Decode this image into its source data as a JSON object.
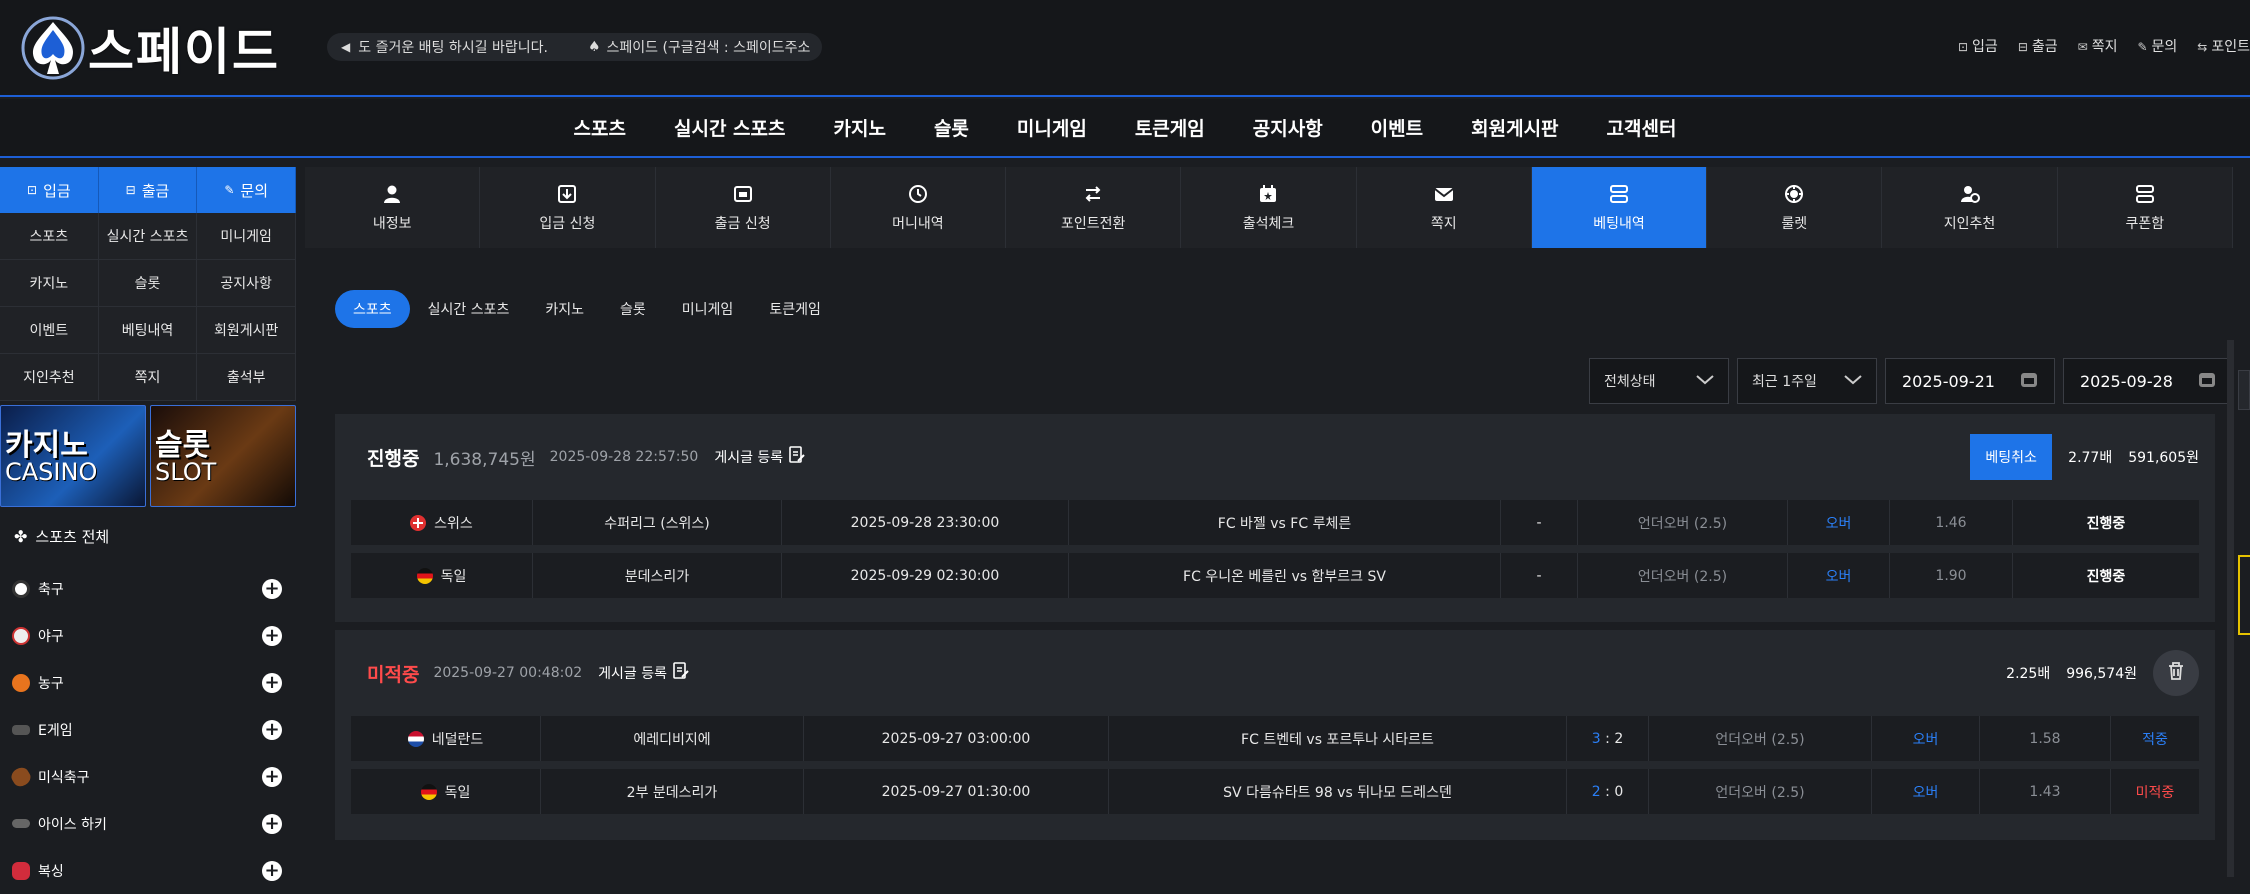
{
  "brand": {
    "name": "스페이드"
  },
  "notice": {
    "text1": "도 즐거운 배팅 하시길 바랍니다.",
    "text2": "스페이드 (구글검색 : 스페이드주소"
  },
  "toplinks": [
    {
      "label": "입금",
      "icon": "deposit-icon"
    },
    {
      "label": "출금",
      "icon": "withdraw-icon"
    },
    {
      "label": "쪽지",
      "icon": "mail-icon"
    },
    {
      "label": "문의",
      "icon": "inquiry-icon"
    },
    {
      "label": "포인트",
      "icon": "point-icon"
    }
  ],
  "mainnav": [
    "스포츠",
    "실시간 스포츠",
    "카지노",
    "슬롯",
    "미니게임",
    "토큰게임",
    "공지사항",
    "이벤트",
    "회원게시판",
    "고객센터"
  ],
  "sidebar": {
    "quick": [
      "입금",
      "출금",
      "문의"
    ],
    "grid": [
      "스포츠",
      "실시간 스포츠",
      "미니게임",
      "카지노",
      "슬롯",
      "공지사항",
      "이벤트",
      "베팅내역",
      "회원게시판",
      "지인추천",
      "쪽지",
      "출석부"
    ],
    "banners": [
      {
        "title": "카지노",
        "sub": "CASINO"
      },
      {
        "title": "슬롯",
        "sub": "SLOT"
      }
    ],
    "sports_all": "스포츠 전체",
    "sports": [
      {
        "name": "축구",
        "color": "#ffffff"
      },
      {
        "name": "야구",
        "color": "#e8e8e8"
      },
      {
        "name": "농구",
        "color": "#e8741e"
      },
      {
        "name": "E게임",
        "color": "#888888"
      },
      {
        "name": "미식축구",
        "color": "#8a4b1e"
      },
      {
        "name": "아이스 하키",
        "color": "#666666"
      },
      {
        "name": "복싱",
        "color": "#d22c3c"
      }
    ]
  },
  "tabs": [
    {
      "label": "내정보",
      "icon": "user-icon"
    },
    {
      "label": "입금 신청",
      "icon": "deposit-request-icon"
    },
    {
      "label": "출금 신청",
      "icon": "withdraw-request-icon"
    },
    {
      "label": "머니내역",
      "icon": "clock-icon"
    },
    {
      "label": "포인트전환",
      "icon": "exchange-icon"
    },
    {
      "label": "출석체크",
      "icon": "calendar-icon"
    },
    {
      "label": "쪽지",
      "icon": "mail-icon"
    },
    {
      "label": "베팅내역",
      "icon": "list-icon",
      "active": true
    },
    {
      "label": "룰렛",
      "icon": "roulette-icon"
    },
    {
      "label": "지인추천",
      "icon": "recommend-icon"
    },
    {
      "label": "쿠폰함",
      "icon": "coupon-icon"
    }
  ],
  "subtabs": [
    "스포츠",
    "실시간 스포츠",
    "카지노",
    "슬롯",
    "미니게임",
    "토큰게임"
  ],
  "filters": {
    "status": "전체상태",
    "period": "최근 1주일",
    "from": "2025-09-21",
    "to": "2025-09-28"
  },
  "bets": [
    {
      "status": "진행중",
      "amount": "1,638,745원",
      "date": "2025-09-28 22:57:50",
      "post": "게시글 등록",
      "cancel": "베팅취소",
      "odds": "2.77배",
      "payout": "591,605원",
      "rows": [
        {
          "country": "스위스",
          "league": "수퍼리그 (스위스)",
          "time": "2025-09-28 23:30:00",
          "match": "FC 바젤 vs FC 루체른",
          "score": "-",
          "market": "언더오버 (2.5)",
          "pick": "오버",
          "odds": "1.46",
          "result": "진행중"
        },
        {
          "country": "독일",
          "league": "분데스리가",
          "time": "2025-09-29 02:30:00",
          "match": "FC 우니온 베를린 vs 함부르크 SV",
          "score": "-",
          "market": "언더오버 (2.5)",
          "pick": "오버",
          "odds": "1.90",
          "result": "진행중"
        }
      ]
    },
    {
      "status": "미적중",
      "date": "2025-09-27 00:48:02",
      "post": "게시글 등록",
      "odds": "2.25배",
      "payout": "996,574원",
      "rows": [
        {
          "country": "네덜란드",
          "league": "에레디비지에",
          "time": "2025-09-27 03:00:00",
          "match": "FC 트벤테 vs 포르투나 시타르트",
          "score_home": "3",
          "score_sep": " : ",
          "score_away": "2",
          "market": "언더오버 (2.5)",
          "pick": "오버",
          "odds": "1.58",
          "result": "적중"
        },
        {
          "country": "독일",
          "league": "2부 분데스리가",
          "time": "2025-09-27 01:30:00",
          "match": "SV 다름슈타트 98 vs 뒤나모 드레스덴",
          "score_home": "2",
          "score_sep": " : ",
          "score_away": "0",
          "market": "언더오버 (2.5)",
          "pick": "오버",
          "odds": "1.43",
          "result": "미적중"
        }
      ]
    }
  ],
  "colors": {
    "accent": "#1e74e8",
    "lose": "#ff4b4b",
    "bg": "#1b1d21"
  }
}
